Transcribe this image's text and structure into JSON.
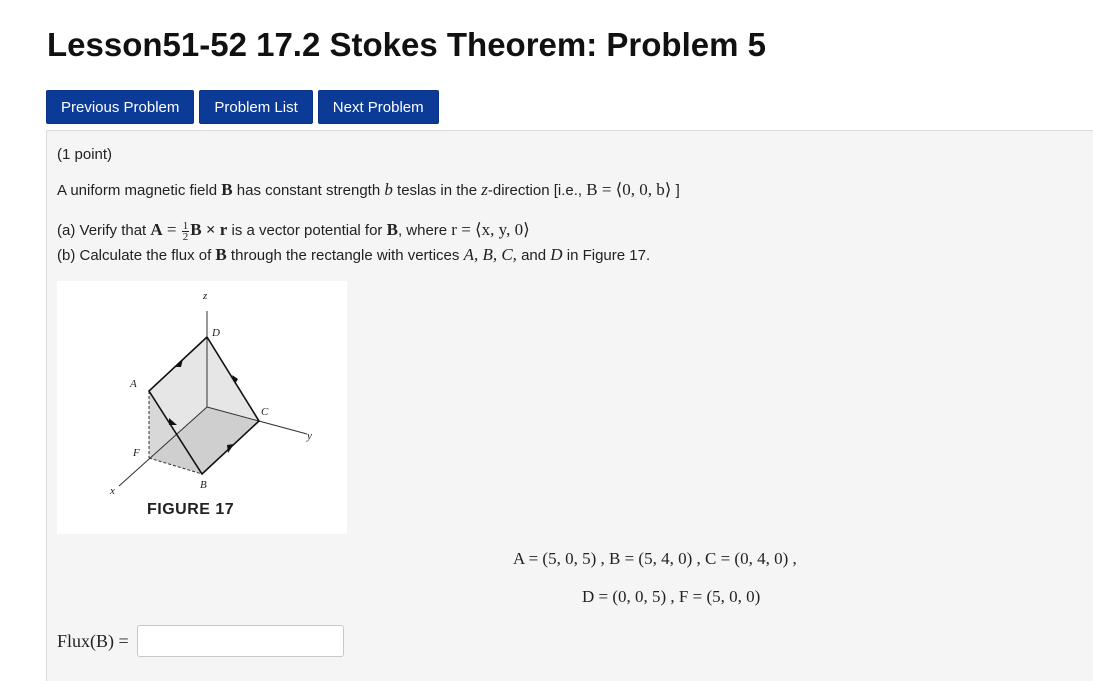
{
  "page": {
    "title": "Lesson51-52 17.2 Stokes Theorem: Problem 5"
  },
  "nav": {
    "previous": "Previous Problem",
    "list": "Problem List",
    "next": "Next Problem"
  },
  "problem": {
    "points": "(1 point)",
    "intro_pre": "A uniform magnetic field ",
    "intro_B": "B",
    "intro_mid1": " has constant strength ",
    "intro_b": "b",
    "intro_mid2": " teslas in the ",
    "intro_z": "z",
    "intro_mid3": "-direction [i.e., ",
    "intro_eq": "B = ⟨0, 0, b⟩",
    "intro_end": " ]",
    "part_a_label": "(a)",
    "part_a_pre": " Verify that ",
    "part_a_A": "A",
    "part_a_eq": " = ",
    "frac_num": "1",
    "frac_den": "2",
    "part_a_cross": "B × r",
    "part_a_mid": " is a vector potential for ",
    "part_a_B": "B",
    "part_a_where": ", where ",
    "part_a_r": "r = ⟨x, y, 0⟩",
    "part_b_label": "(b)",
    "part_b_pre": " Calculate the flux of ",
    "part_b_B": "B",
    "part_b_mid": " through the rectangle with vertices ",
    "part_b_vertices": "A, B, C,",
    "part_b_and": " and ",
    "part_b_D": "D",
    "part_b_end": " in Figure 17."
  },
  "figure": {
    "caption": "FIGURE 17",
    "labels": {
      "z": "z",
      "D": "D",
      "A": "A",
      "C": "C",
      "y": "y",
      "F": "F",
      "B": "B",
      "x": "x"
    }
  },
  "vertices": {
    "line1": "A = (5, 0, 5) ,   B = (5, 4, 0) ,   C = (0, 4, 0) ,",
    "line2": "D = (0, 0, 5) ,   F = (5, 0, 0)"
  },
  "answer": {
    "label": "Flux(B) =",
    "value": ""
  }
}
